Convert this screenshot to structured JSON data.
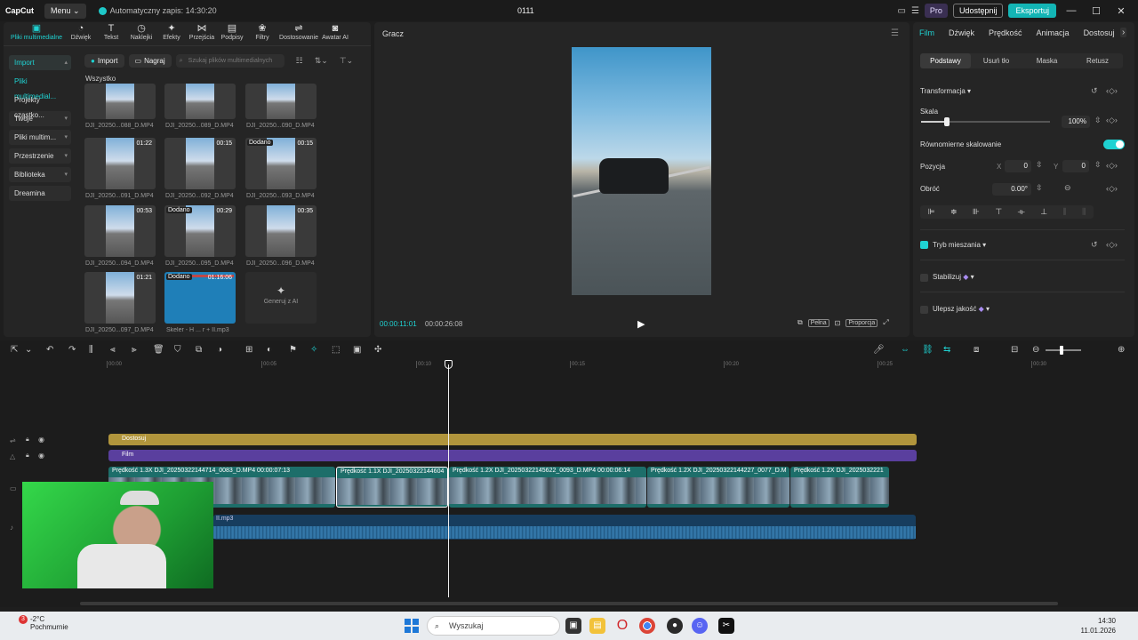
{
  "titlebar": {
    "logo": "CapCut",
    "menu": "Menu",
    "autosave": "Automatyczny zapis: 14:30:20",
    "project": "0111",
    "pro": "Pro",
    "share": "Udostępnij",
    "export": "Eksportuj",
    "minimize": "—",
    "maximize": "☐",
    "close": "✕"
  },
  "media_tabs": [
    {
      "label": "Pliki multimedialne",
      "icon": "media-icon",
      "glyph": "▣"
    },
    {
      "label": "Dźwięk",
      "icon": "audio-icon",
      "glyph": "◔"
    },
    {
      "label": "Tekst",
      "icon": "text-icon",
      "glyph": "T"
    },
    {
      "label": "Naklejki",
      "icon": "sticker-icon",
      "glyph": "◷"
    },
    {
      "label": "Efekty",
      "icon": "effects-icon",
      "glyph": "✦"
    },
    {
      "label": "Przejścia",
      "icon": "transitions-icon",
      "glyph": "⋈"
    },
    {
      "label": "Podpisy",
      "icon": "captions-icon",
      "glyph": "▤"
    },
    {
      "label": "Filtry",
      "icon": "filters-icon",
      "glyph": "❀"
    },
    {
      "label": "Dostosowanie",
      "icon": "adjust-icon",
      "glyph": "⇌"
    },
    {
      "label": "Awatar AI",
      "icon": "avatar-icon",
      "glyph": "◙"
    }
  ],
  "sidebar": {
    "items": [
      "Import",
      "Pliki multimedial...",
      "Projekty cząstko...",
      "Twoje",
      "Pliki multim...",
      "Przestrzenie",
      "Biblioteka",
      "Dreamina"
    ]
  },
  "media": {
    "import": "Import",
    "record": "Nagraj",
    "search_placeholder": "Szukaj plików multimedialnych",
    "section": "Wszystko",
    "generate_ai": "Generuj z AI",
    "items": [
      {
        "name": "DJI_20250...088_D.MP4",
        "duration": "",
        "added": ""
      },
      {
        "name": "DJI_20250...089_D.MP4",
        "duration": "",
        "added": ""
      },
      {
        "name": "DJI_20250...090_D.MP4",
        "duration": "",
        "added": ""
      },
      {
        "name": "DJI_20250...091_D.MP4",
        "duration": "01:22",
        "added": ""
      },
      {
        "name": "DJI_20250...092_D.MP4",
        "duration": "00:15",
        "added": ""
      },
      {
        "name": "DJI_20250...093_D.MP4",
        "duration": "00:15",
        "added": "Dodano"
      },
      {
        "name": "DJI_20250...094_D.MP4",
        "duration": "00:53",
        "added": ""
      },
      {
        "name": "DJI_20250...095_D.MP4",
        "duration": "00:29",
        "added": "Dodano"
      },
      {
        "name": "DJI_20250...096_D.MP4",
        "duration": "00:35",
        "added": ""
      },
      {
        "name": "DJI_20250...097_D.MP4",
        "duration": "01:21",
        "added": ""
      },
      {
        "name": "Skeler - H ... r + II.mp3",
        "duration": "01:16:06",
        "added": "Dodano"
      }
    ]
  },
  "player": {
    "title": "Gracz",
    "current_time": "00:00:11:01",
    "total_time": "00:00:26:08",
    "full": "Pełna",
    "ratio": "Proporcja"
  },
  "props": {
    "tabs": [
      "Film",
      "Dźwięk",
      "Prędkość",
      "Animacja",
      "Dostosuj"
    ],
    "sub_tabs": [
      "Podstawy",
      "Usuń tło",
      "Maska",
      "Retusz"
    ],
    "transform": "Transformacja",
    "scale_label": "Skala",
    "scale_value": "100%",
    "scale_fraction": 0.2,
    "uniform_scale": "Równomierne skalowanie",
    "position_label": "Pozycja",
    "pos_x_label": "X",
    "pos_x": "0",
    "pos_y_label": "Y",
    "pos_y": "0",
    "rotate_label": "Obróć",
    "rotate_value": "0.00°",
    "blend": "Tryb mieszania",
    "stabilize": "Stabilizuj",
    "enhance": "Ulepsz jakość"
  },
  "timeline": {
    "ruler": [
      "00:00",
      "00:05",
      "00:10",
      "00:15",
      "00:20",
      "00:25",
      "00:30"
    ],
    "adjust_track": "Dostosuj",
    "film_track": "Film",
    "clips": [
      {
        "label": "Prędkość 1.3X   DJI_20250322144714_0083_D.MP4   00:00:07:13"
      },
      {
        "label": "Prędkość 1.1X   DJI_20250322144604"
      },
      {
        "label": "Prędkość 1.2X   DJI_20250322145622_0093_D.MP4   00:00:06:14"
      },
      {
        "label": "Prędkość 1.2X   DJI_20250322144227_0077_D.M"
      },
      {
        "label": "Prędkość 1.2X   DJI_2025032221"
      }
    ],
    "audio": "II.mp3"
  },
  "taskbar": {
    "weather_temp": "-2°C",
    "weather_desc": "Pochmurnie",
    "weather_badge": "3",
    "search": "Wyszukaj",
    "time": "14:30",
    "date": "11.01.2026"
  }
}
